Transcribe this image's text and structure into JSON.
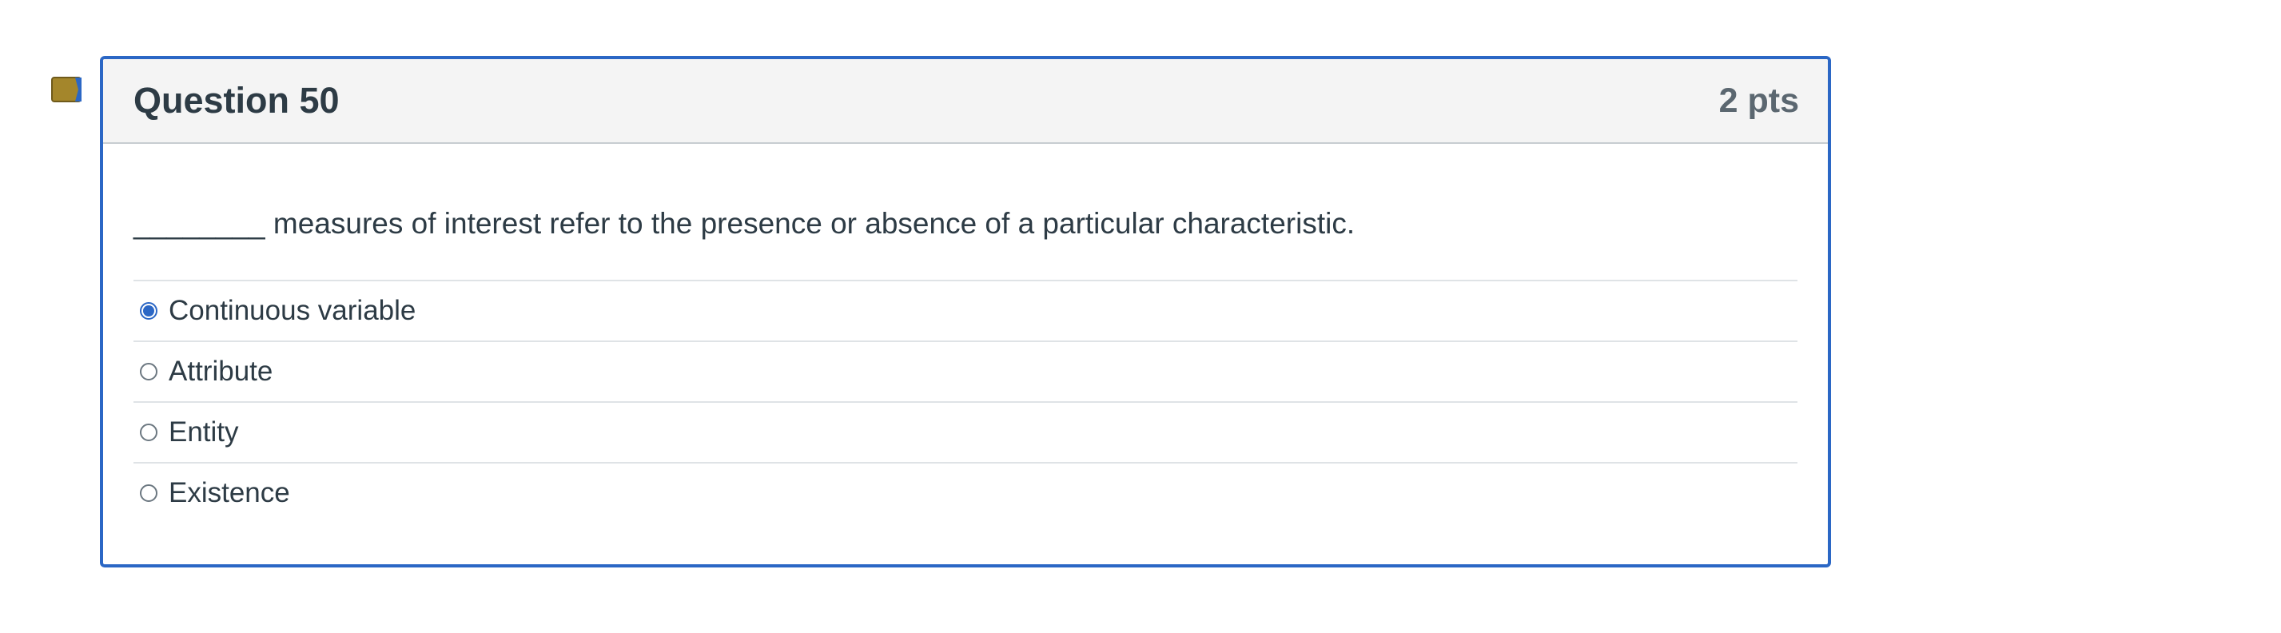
{
  "question": {
    "title": "Question 50",
    "points": "2 pts",
    "text": "________ measures of interest refer to the presence or absence of a particular characteristic.",
    "flag_icon": "bookmark-flag-icon",
    "flag_color": "#a4862b",
    "accent_color": "#2b67c5"
  },
  "answers": [
    {
      "label": "Continuous variable",
      "selected": true
    },
    {
      "label": "Attribute",
      "selected": false
    },
    {
      "label": "Entity",
      "selected": false
    },
    {
      "label": "Existence",
      "selected": false
    }
  ]
}
